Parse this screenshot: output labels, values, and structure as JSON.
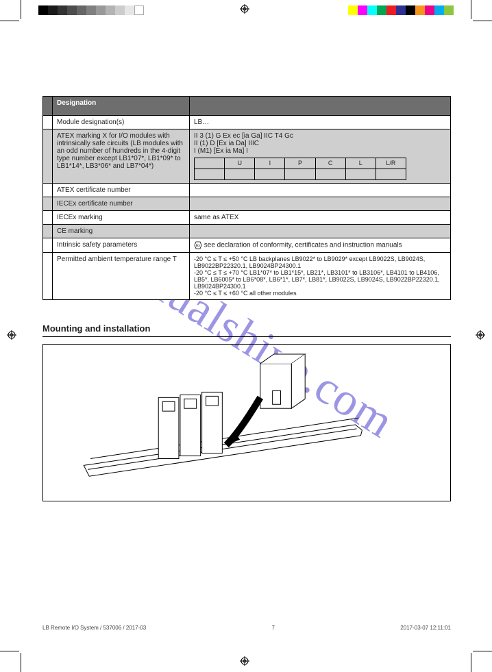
{
  "watermark": "manualshive.com",
  "header": {
    "designation": "Designation",
    "blank": ""
  },
  "rows": [
    {
      "stub": "",
      "label": "Module designation(s)",
      "value": "LB…",
      "shade": "light"
    },
    {
      "stub": "",
      "label": "ATEX marking X for I/O modules with intrinsically safe circuits (LB modules with an odd number of hundreds in the 4-digit type number except LB1*07*, LB1*09* to LB1*14*, LB3*06* and LB7*04*)",
      "value": "II 3 (1) G Ex ec [ia Ga] IIC T4 Gc\nII (1) D [Ex ia Da] IIIC\nI (M1) [Ex ia Ma] I",
      "shade": "dark",
      "hasInner": true
    },
    {
      "stub": "",
      "label": "ATEX certificate number",
      "value": "",
      "shade": "light"
    },
    {
      "stub": "",
      "label": "IECEx certificate number",
      "value": "",
      "shade": "dark"
    },
    {
      "stub": "",
      "label": "IECEx marking",
      "value": "same as ATEX",
      "shade": "light"
    },
    {
      "stub": "",
      "label": "CE marking",
      "value": "",
      "shade": "dark"
    },
    {
      "stub": "",
      "label": "Intrinsic safety parameters",
      "value": "see declaration of conformity, certificates and instruction manuals",
      "shade": "light",
      "hasEx": true
    },
    {
      "stub": "",
      "label": "Permitted ambient temperature range T",
      "value": "-20 °C ≤ T ≤ +50 °C   LB backplanes LB9022* to LB9029* except LB9022S, LB9024S, LB9022BP22320.1, LB9024BP24300.1\n-20 °C ≤ T ≤ +70 °C   LB1*07* to LB1*15*, LB21*, LB3101* to LB3106*, LB4101 to LB4106, LB5*, LB6005* to LB6*08*, LB6*1*, LB7*, LB81*, LB9022S, LB9024S, LB9022BP22320.1, LB9024BP24300.1\n-20 °C ≤ T ≤ +60 °C   all other modules",
      "shade": "light"
    }
  ],
  "innerHeaders": [
    "",
    "U",
    "I",
    "P",
    "C",
    "L",
    "L/R"
  ],
  "innerRow": [
    "",
    "",
    "",
    "",
    "",
    "",
    "",
    ""
  ],
  "section": {
    "title": "Mounting and installation"
  },
  "footer": {
    "left": "",
    "right": "",
    "indd": "LB Remote I/O System / 537006 / 2017-03",
    "timestamp": "2017-03-07 12:11:01"
  },
  "page_number": "7"
}
